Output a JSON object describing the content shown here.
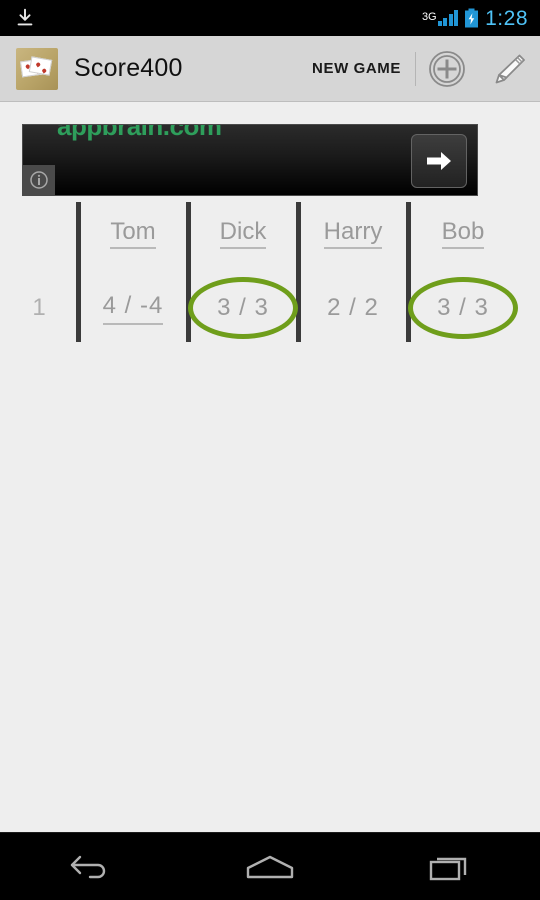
{
  "statusbar": {
    "download_icon": "download-icon",
    "network_label": "3G",
    "signal_icon": "signal-bars-icon",
    "battery_icon": "battery-charging-icon",
    "time": "1:28"
  },
  "actionbar": {
    "app_icon": "playing-cards-app-icon",
    "title": "Score400",
    "new_game_label": "NEW GAME",
    "add_icon": "circle-plus-icon",
    "edit_icon": "pencil-icon"
  },
  "ad": {
    "text": "appbrain.com",
    "info_icon": "info-icon",
    "arrow_icon": "arrow-right-icon"
  },
  "board": {
    "row_number": "1",
    "players": [
      {
        "name": "Tom",
        "score": "4 / -4",
        "highlighted": false,
        "score_underlined": true
      },
      {
        "name": "Dick",
        "score": "3 / 3",
        "highlighted": true,
        "score_underlined": false
      },
      {
        "name": "Harry",
        "score": "2 / 2",
        "highlighted": false,
        "score_underlined": false
      },
      {
        "name": "Bob",
        "score": "3 / 3",
        "highlighted": true,
        "score_underlined": false
      }
    ]
  },
  "navbar": {
    "back_icon": "back-arrow-icon",
    "home_icon": "home-icon",
    "recents_icon": "recent-apps-icon"
  },
  "colors": {
    "highlight_ring": "#6f9e1b",
    "ad_text": "#2e9e5b",
    "accent_clock": "#4fc3f7",
    "divider": "#3a3a3a"
  }
}
